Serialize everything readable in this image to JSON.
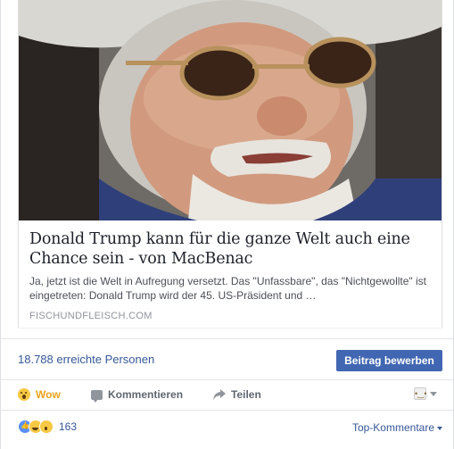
{
  "link_preview": {
    "title": "Donald Trump kann für die ganze Welt auch eine Chance sein - von MacBenac",
    "description": "Ja, jetzt ist die Welt in Aufregung versetzt. Das \"Unfassbare\", das \"Nichtgewollte\" ist eingetreten: Donald Trump wird der 45. US-Präsident und …",
    "source": "FISCHUNDFLEISCH.COM"
  },
  "reach": {
    "people_reached": "18.788 erreichte Personen",
    "boost_label": "Beitrag bewerben",
    "boost_color": "#4267b2"
  },
  "actions": {
    "reaction_label": "Wow",
    "reaction_color": "#e9a21d",
    "comment_label": "Kommentieren",
    "share_label": "Teilen"
  },
  "summary": {
    "reaction_icons": [
      "like-icon",
      "haha-icon",
      "wow-icon"
    ],
    "reaction_count": "163",
    "sort_label": "Top-Kommentare"
  }
}
